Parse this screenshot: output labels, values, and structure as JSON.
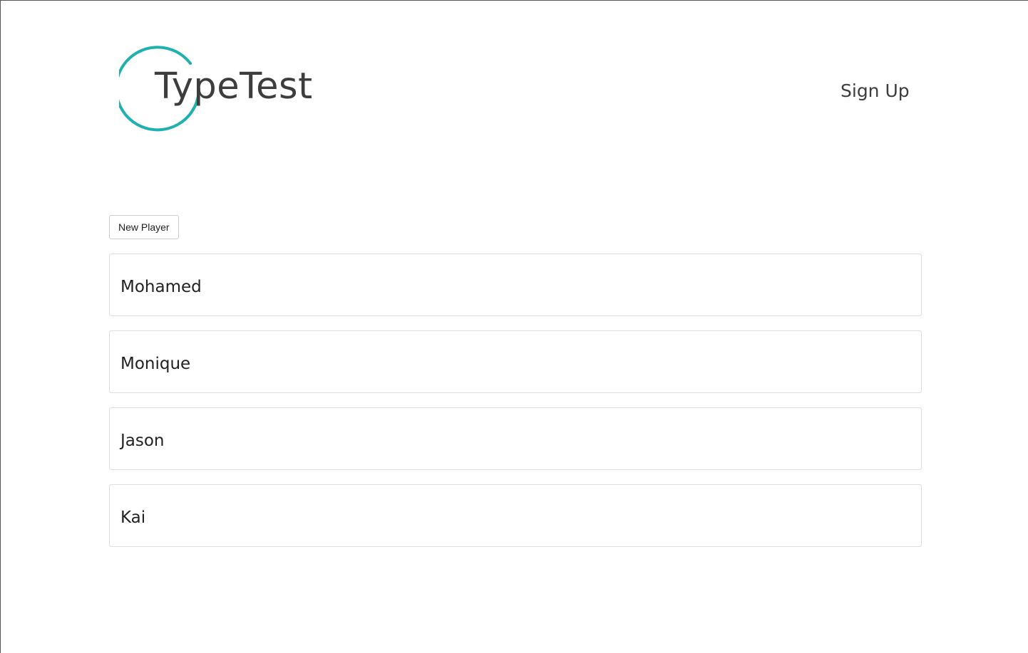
{
  "brand": {
    "name": "TypeTest",
    "accent_color": "#1fb0b0",
    "icon": "ring-logo"
  },
  "nav": {
    "signup_label": "Sign Up"
  },
  "toolbar": {
    "new_player_label": "New Player"
  },
  "players": [
    {
      "name": "Mohamed"
    },
    {
      "name": "Monique"
    },
    {
      "name": "Jason"
    },
    {
      "name": "Kai"
    }
  ]
}
